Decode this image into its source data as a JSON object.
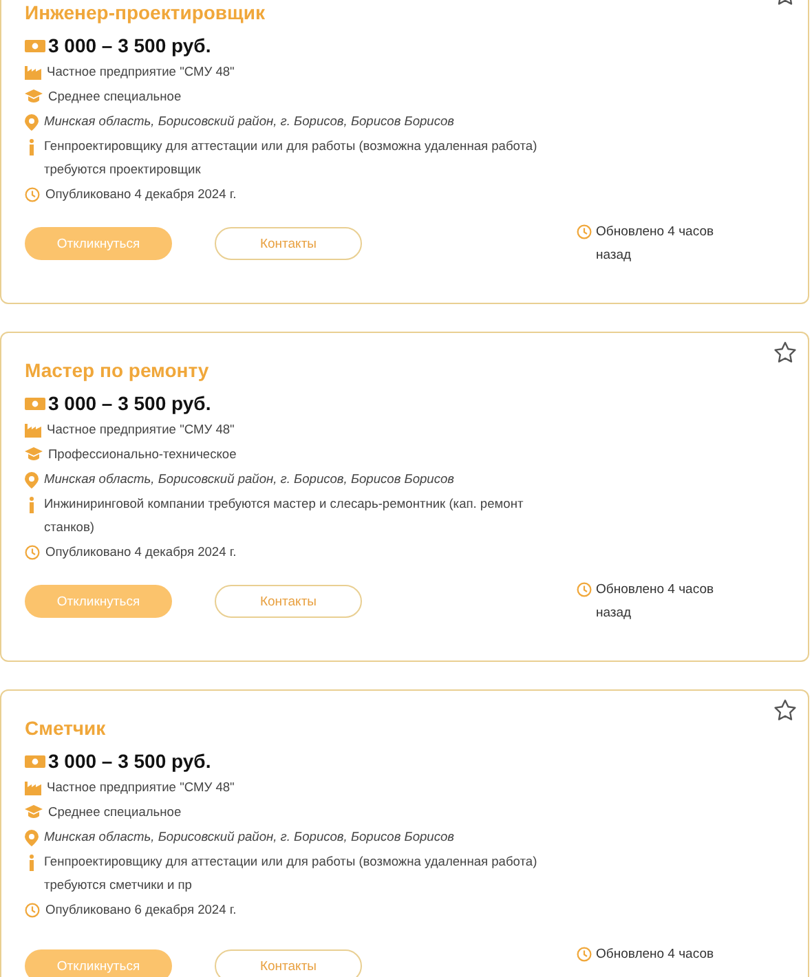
{
  "vacancies": [
    {
      "title": "Инженер-проектировщик",
      "salary": "3 000 – 3 500 руб.",
      "details": [
        {
          "kind": "company",
          "text": "Частное предприятие \"СМУ 48\""
        },
        {
          "kind": "education",
          "text": "Среднее специальное"
        },
        {
          "kind": "location",
          "text": "Минская область, Борисовский район, г. Борисов, Борисов Борисов"
        },
        {
          "kind": "description",
          "text": "Генпроектировщику для аттестации или для работы (возможна удаленная работа) требуются проектировщик"
        },
        {
          "kind": "published",
          "text": "Опубликовано 4 декабря 2024 г."
        }
      ],
      "apply_label": "Откликнуться",
      "contacts_label": "Контакты",
      "updated": "Обновлено 4 часов назад"
    },
    {
      "title": "Мастер по ремонту",
      "salary": "3 000 – 3 500 руб.",
      "details": [
        {
          "kind": "company",
          "text": "Частное предприятие \"СМУ 48\""
        },
        {
          "kind": "education",
          "text": "Профессионально-техническое"
        },
        {
          "kind": "location",
          "text": "Минская область, Борисовский район, г. Борисов, Борисов Борисов"
        },
        {
          "kind": "description",
          "text": "Инжиниринговой компании требуются мастер и слесарь-ремонтник (кап. ремонт станков)"
        },
        {
          "kind": "published",
          "text": "Опубликовано 4 декабря 2024 г."
        }
      ],
      "apply_label": "Откликнуться",
      "contacts_label": "Контакты",
      "updated": "Обновлено 4 часов назад"
    },
    {
      "title": "Сметчик",
      "salary": "3 000 – 3 500 руб.",
      "details": [
        {
          "kind": "company",
          "text": "Частное предприятие \"СМУ 48\""
        },
        {
          "kind": "education",
          "text": "Среднее специальное"
        },
        {
          "kind": "location",
          "text": "Минская область, Борисовский район, г. Борисов, Борисов Борисов"
        },
        {
          "kind": "description",
          "text": "Генпроектировщику для аттестации или для работы (возможна удаленная работа) требуются сметчики и пр"
        },
        {
          "kind": "published",
          "text": "Опубликовано 6 декабря 2024 г."
        }
      ],
      "apply_label": "Откликнуться",
      "contacts_label": "Контакты",
      "updated": "Обновлено 4 часов"
    }
  ]
}
